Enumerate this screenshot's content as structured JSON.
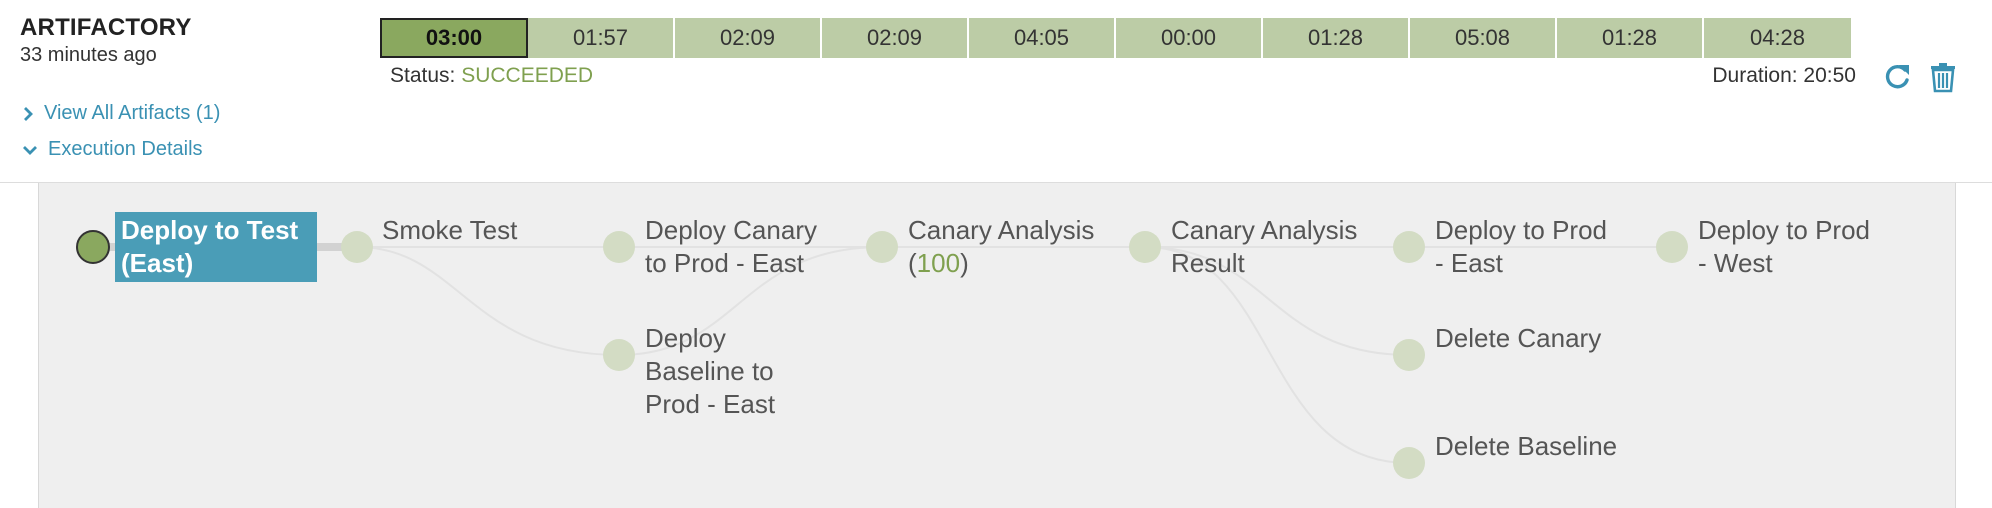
{
  "header": {
    "title": "ARTIFACTORY",
    "subtitle": "33 minutes ago"
  },
  "stages": [
    {
      "label": "03:00",
      "active": true
    },
    {
      "label": "01:57",
      "active": false
    },
    {
      "label": "02:09",
      "active": false
    },
    {
      "label": "02:09",
      "active": false
    },
    {
      "label": "04:05",
      "active": false
    },
    {
      "label": "00:00",
      "active": false
    },
    {
      "label": "01:28",
      "active": false
    },
    {
      "label": "05:08",
      "active": false
    },
    {
      "label": "01:28",
      "active": false
    },
    {
      "label": "04:28",
      "active": false
    }
  ],
  "status": {
    "label": "Status:",
    "value": "SUCCEEDED",
    "value_color": "#7fa04f"
  },
  "duration": {
    "label": "Duration: 20:50"
  },
  "links": {
    "view_artifacts": "View All Artifacts (1)",
    "execution_details": "Execution Details"
  },
  "actions": {
    "restart_icon": "refresh-icon",
    "delete_icon": "trash-icon",
    "icon_color": "#3a91b3"
  },
  "pipeline": {
    "nodes": [
      {
        "id": "deploy-test-east",
        "line1": "Deploy to Test",
        "line2": "(East)",
        "selected": true,
        "done": true
      },
      {
        "id": "smoke-test",
        "line1": "Smoke Test"
      },
      {
        "id": "deploy-canary",
        "line1": "Deploy Canary",
        "line2": "to Prod - East"
      },
      {
        "id": "deploy-baseline",
        "line1": "Deploy",
        "line2": "Baseline to",
        "line3": "Prod - East"
      },
      {
        "id": "canary-analysis",
        "line1": "Canary Analysis",
        "line2_prefix": "(",
        "line2_number": "100",
        "line2_suffix": ")"
      },
      {
        "id": "canary-analysis-result",
        "line1": "Canary Analysis",
        "line2": "Result"
      },
      {
        "id": "deploy-prod-east",
        "line1": "Deploy to Prod",
        "line2": "- East"
      },
      {
        "id": "delete-canary",
        "line1": "Delete Canary"
      },
      {
        "id": "delete-baseline",
        "line1": "Delete Baseline"
      },
      {
        "id": "deploy-prod-west",
        "line1": "Deploy to Prod",
        "line2": "- West"
      }
    ]
  },
  "colors": {
    "accent": "#3a91b3",
    "selected_node": "#4a9db7",
    "succeeded": "#7fa04f",
    "stage_bar": "#bccca6",
    "stage_active": "#8aa85f",
    "pending_dot": "#d3dcc4"
  }
}
